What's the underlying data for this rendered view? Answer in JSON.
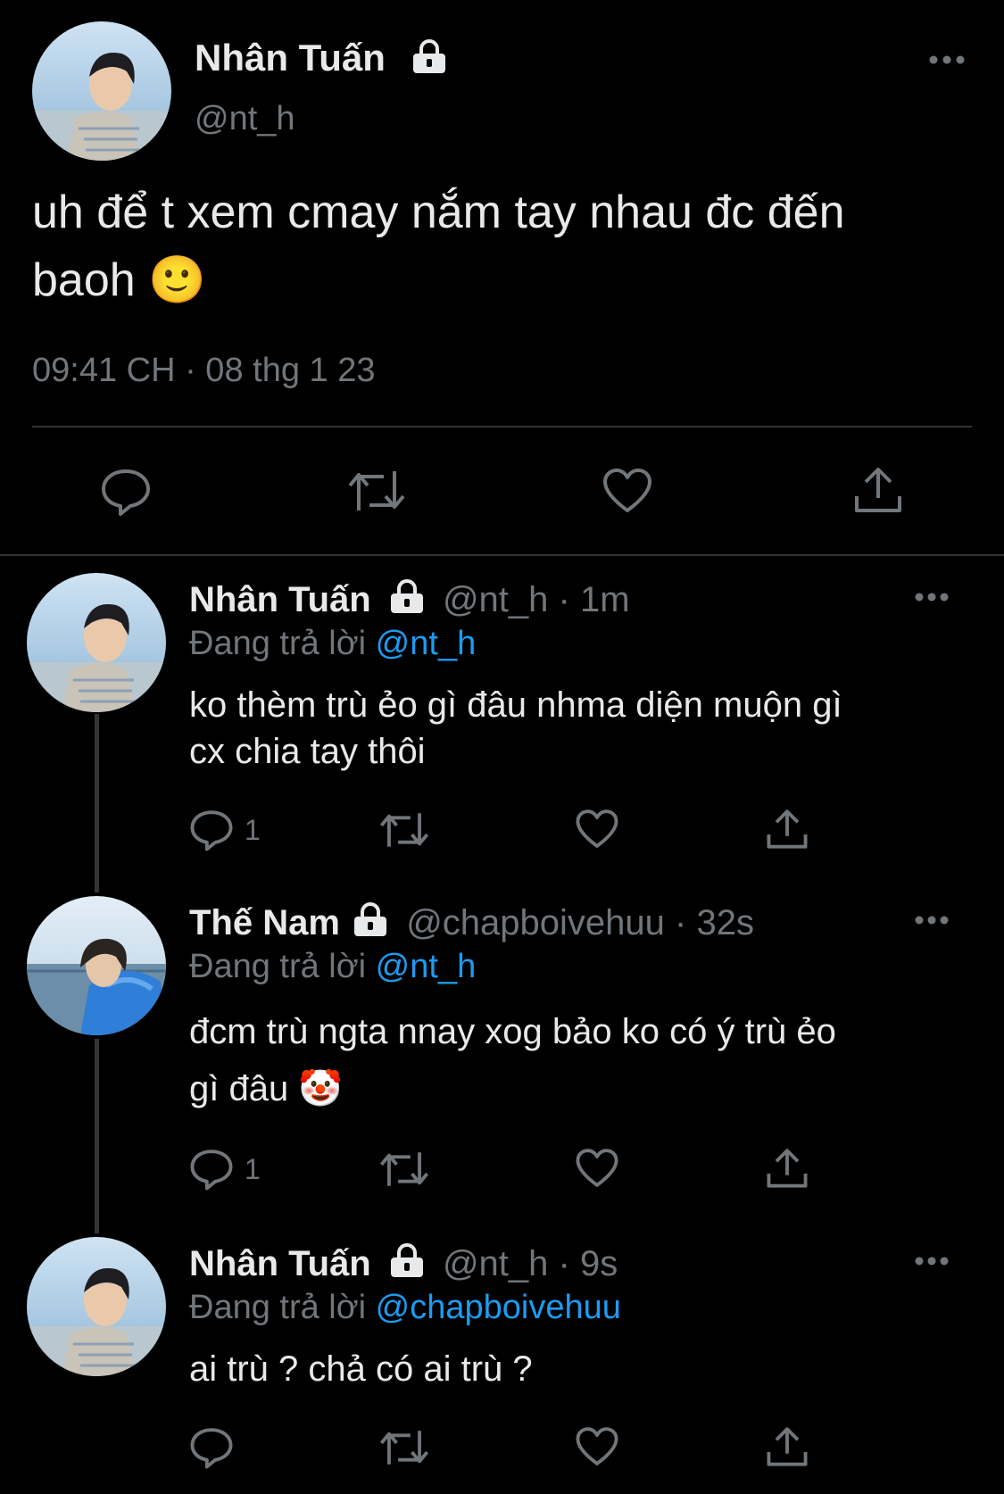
{
  "main_tweet": {
    "name": "Nhân Tuấn",
    "handle": "@nt_h",
    "text_line1": "uh để t xem cmay nắm tay nhau đc đến",
    "text_line2": "baoh",
    "emoji": "🙂",
    "timestamp": "09:41 CH · 08 thg 1 23"
  },
  "replies": [
    {
      "name": "Nhân Tuấn",
      "handle": "@nt_h",
      "time": "· 1m",
      "replying_prefix": "Đang trả lời",
      "replying_to": "@nt_h",
      "text_line1": "ko thèm trù ẻo gì đâu nhma diện muộn gì",
      "text_line2": "cx chia tay thôi",
      "reply_count": "1"
    },
    {
      "name": "Thế Nam",
      "handle": "@chapboivehuu",
      "time": "· 32s",
      "replying_prefix": "Đang trả lời",
      "replying_to": "@nt_h",
      "text_line1": "đcm trù ngta nnay xog bảo ko có ý trù ẻo",
      "text_line2": "gì đâu",
      "emoji": "🤡",
      "reply_count": "1"
    },
    {
      "name": "Nhân Tuấn",
      "handle": "@nt_h",
      "time": "· 9s",
      "replying_prefix": "Đang trả lời",
      "replying_to": "@chapboivehuu",
      "text_line1": "ai trù ? chả có ai trù ?"
    }
  ],
  "icons": {
    "more": "more-dots-icon",
    "lock": "lock-icon",
    "reply": "reply-icon",
    "retweet": "retweet-icon",
    "like": "heart-icon",
    "share": "share-icon"
  },
  "colors": {
    "background": "#000000",
    "text": "#e7e9ea",
    "muted": "#71767b",
    "link": "#1d9bf0",
    "divider": "#2f3336"
  }
}
